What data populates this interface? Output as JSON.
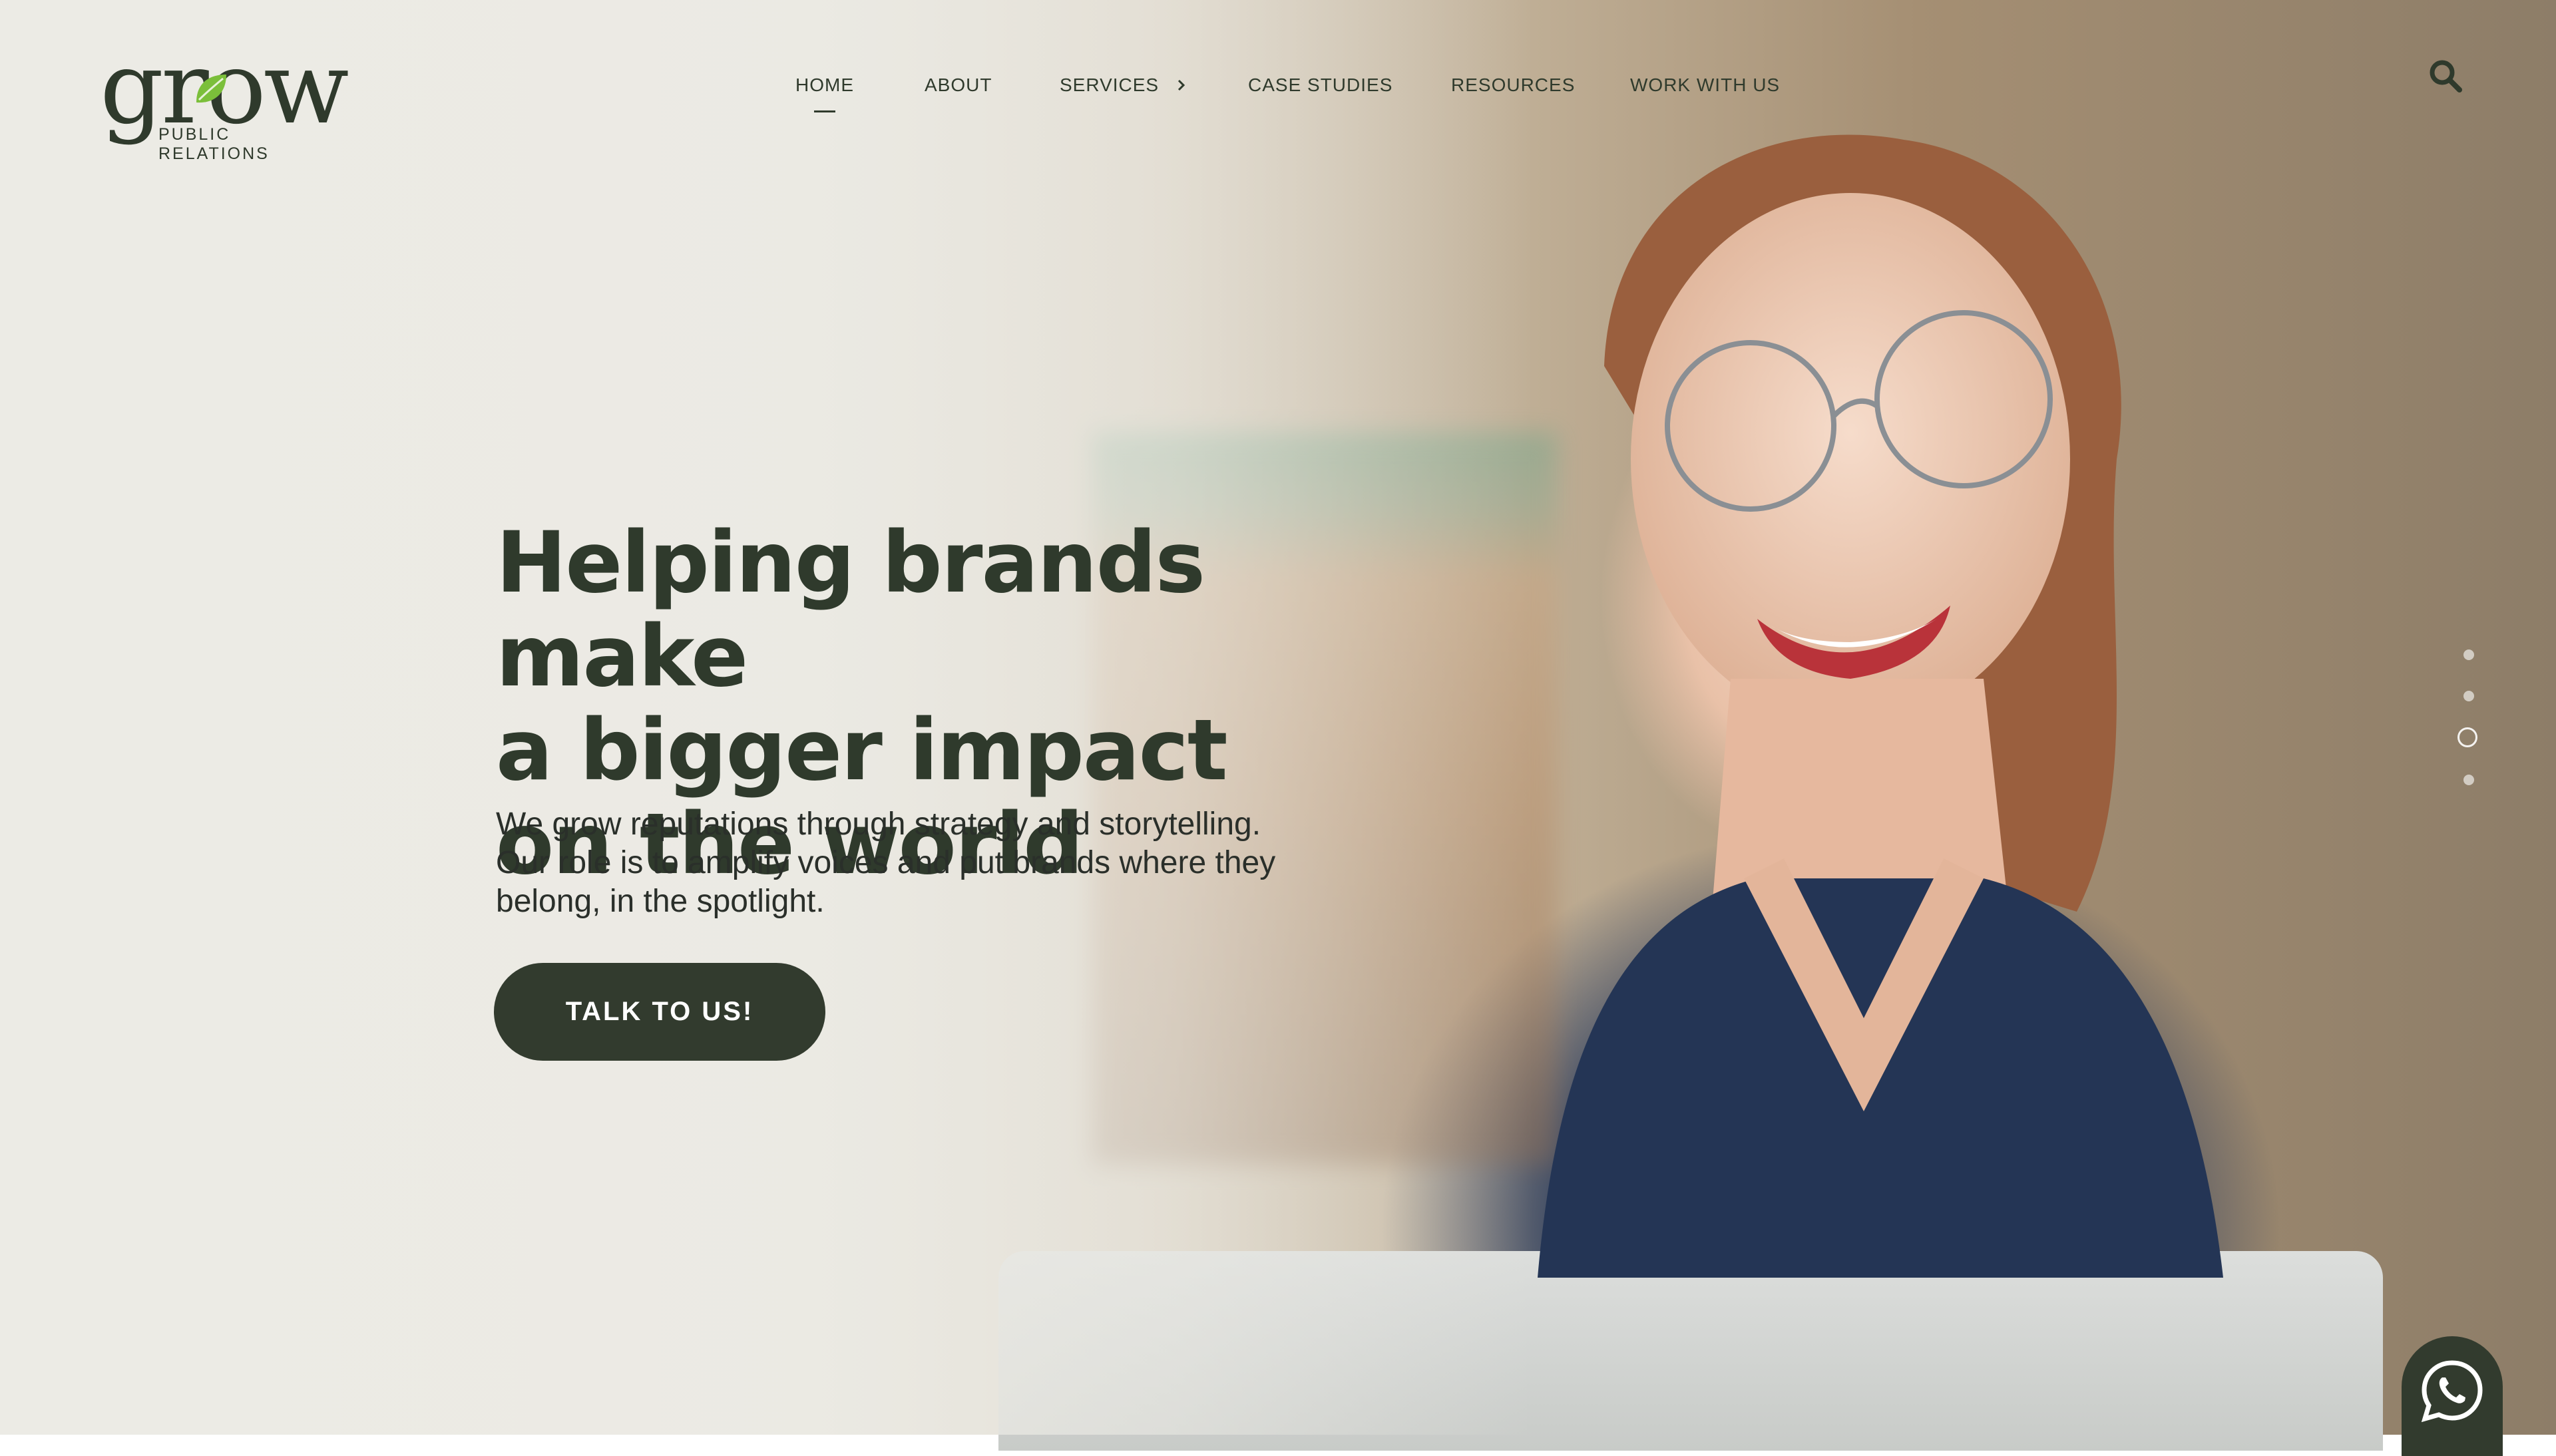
{
  "brand": {
    "wordmark": "grow",
    "tagline": "PUBLIC RELATIONS"
  },
  "nav": {
    "items": [
      {
        "label": "HOME",
        "active": true
      },
      {
        "label": "ABOUT"
      },
      {
        "label": "SERVICES",
        "has_submenu": true
      },
      {
        "label": "CASE STUDIES"
      },
      {
        "label": "RESOURCES"
      },
      {
        "label": "WORK WITH US"
      }
    ],
    "search_icon": "search-icon"
  },
  "hero": {
    "headline_lines": [
      "Helping brands make",
      "a bigger impact",
      "on the world"
    ],
    "subtitle_lines": [
      "We grow reputations through strategy and storytelling.",
      "Our role is to amplify voices and put brands where they",
      "belong, in the spotlight."
    ],
    "cta_label": "TALK TO US!"
  },
  "slider": {
    "slide_count": 4,
    "active_index": 2
  },
  "floating_button": {
    "icon": "whatsapp-icon"
  },
  "colors": {
    "brand_dark": "#323b2e",
    "leaf_green": "#7bbf3a",
    "text": "#2f3a2c"
  }
}
